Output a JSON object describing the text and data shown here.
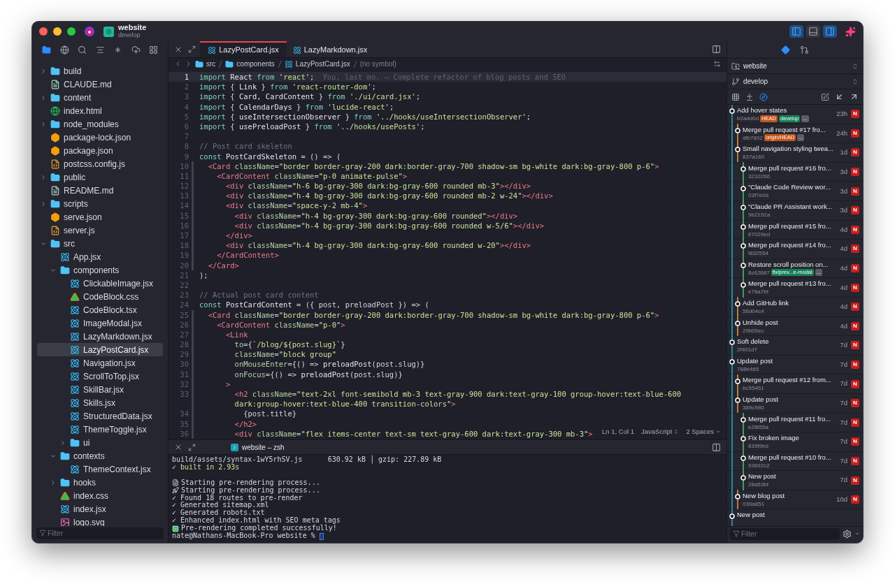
{
  "window": {
    "repo": "website",
    "branch": "develop"
  },
  "sidebar_tabs": [
    {
      "selected": true
    },
    {
      "selected": false
    },
    {
      "selected": false
    },
    {
      "selected": false
    },
    {
      "selected": false
    },
    {
      "selected": false
    },
    {
      "selected": false
    }
  ],
  "tree": [
    {
      "name": "build",
      "kind": "folder",
      "expanded": false,
      "selected": false
    },
    {
      "name": "CLAUDE.md",
      "kind": "markdown",
      "selected": false
    },
    {
      "name": "content",
      "kind": "folder",
      "expanded": false,
      "selected": false
    },
    {
      "name": "index.html",
      "kind": "html",
      "selected": false
    },
    {
      "name": "node_modules",
      "kind": "modules",
      "expanded": false,
      "selected": false
    },
    {
      "name": "package-lock.json",
      "kind": "json",
      "selected": false
    },
    {
      "name": "package.json",
      "kind": "json",
      "selected": false
    },
    {
      "name": "postcss.config.js",
      "kind": "js",
      "selected": false
    },
    {
      "name": "public",
      "kind": "folder",
      "expanded": false,
      "selected": false
    },
    {
      "name": "README.md",
      "kind": "markdown",
      "selected": false
    },
    {
      "name": "scripts",
      "kind": "folder",
      "expanded": false,
      "selected": false
    },
    {
      "name": "serve.json",
      "kind": "json",
      "selected": false
    },
    {
      "name": "server.js",
      "kind": "js",
      "selected": false
    },
    {
      "name": "src",
      "kind": "folder",
      "expanded": true,
      "selected": false,
      "children": [
        {
          "name": "App.jsx",
          "kind": "jsx",
          "selected": false
        },
        {
          "name": "components",
          "kind": "folder",
          "expanded": true,
          "selected": false,
          "children": [
            {
              "name": "ClickableImage.jsx",
              "kind": "jsx",
              "selected": false
            },
            {
              "name": "CodeBlock.css",
              "kind": "css",
              "selected": false
            },
            {
              "name": "CodeBlock.tsx",
              "kind": "jsx",
              "selected": false
            },
            {
              "name": "ImageModal.jsx",
              "kind": "jsx",
              "selected": false
            },
            {
              "name": "LazyMarkdown.jsx",
              "kind": "jsx",
              "selected": false
            },
            {
              "name": "LazyPostCard.jsx",
              "kind": "jsx",
              "selected": true
            },
            {
              "name": "Navigation.jsx",
              "kind": "jsx",
              "selected": false
            },
            {
              "name": "ScrollToTop.jsx",
              "kind": "jsx",
              "selected": false
            },
            {
              "name": "SkillBar.jsx",
              "kind": "jsx",
              "selected": false
            },
            {
              "name": "Skills.jsx",
              "kind": "jsx",
              "selected": false
            },
            {
              "name": "StructuredData.jsx",
              "kind": "jsx",
              "selected": false
            },
            {
              "name": "ThemeToggle.jsx",
              "kind": "jsx",
              "selected": false
            },
            {
              "name": "ui",
              "kind": "folder",
              "expanded": false,
              "selected": false
            }
          ]
        },
        {
          "name": "contexts",
          "kind": "folder",
          "expanded": true,
          "selected": false,
          "children": [
            {
              "name": "ThemeContext.jsx",
              "kind": "jsx",
              "selected": false
            }
          ]
        },
        {
          "name": "hooks",
          "kind": "folder",
          "expanded": false,
          "selected": false
        },
        {
          "name": "index.css",
          "kind": "css",
          "selected": false
        },
        {
          "name": "index.jsx",
          "kind": "jsx",
          "selected": false
        },
        {
          "name": "logo.svg",
          "kind": "svg",
          "selected": false
        }
      ]
    }
  ],
  "sidebar_filter": {
    "placeholder": "Filter"
  },
  "editor_tabs": [
    {
      "label": "LazyPostCard.jsx",
      "selected": true
    },
    {
      "label": "LazyMarkdown.jsx",
      "selected": false
    }
  ],
  "breadcrumbs": [
    {
      "text": "src",
      "kind": "folder"
    },
    {
      "text": "components",
      "kind": "folder"
    },
    {
      "text": "LazyPostCard.jsx",
      "kind": "jsx"
    },
    {
      "text": "(no symbol)",
      "kind": "symbol"
    }
  ],
  "code": [
    {
      "n": "1",
      "current": true,
      "changed": false,
      "t": [
        {
          "kind": "kw",
          "text": "import "
        },
        {
          "kind": "id",
          "text": "React "
        },
        {
          "kind": "kw",
          "text": "from "
        },
        {
          "kind": "str",
          "text": "'react'"
        },
        {
          "kind": "punct",
          "text": ";"
        }
      ],
      "blame": "You, last mo. — Complete refactor of blog posts and SEO"
    },
    {
      "n": "2",
      "current": false,
      "changed": false,
      "t": [
        {
          "kind": "kw",
          "text": "import "
        },
        {
          "kind": "punct",
          "text": "{ "
        },
        {
          "kind": "id",
          "text": "Link "
        },
        {
          "kind": "punct",
          "text": "} "
        },
        {
          "kind": "kw",
          "text": "from "
        },
        {
          "kind": "str",
          "text": "'react-router-dom'"
        },
        {
          "kind": "punct",
          "text": ";"
        }
      ]
    },
    {
      "n": "3",
      "current": false,
      "changed": false,
      "t": [
        {
          "kind": "kw",
          "text": "import "
        },
        {
          "kind": "punct",
          "text": "{ "
        },
        {
          "kind": "id",
          "text": "Card, CardContent "
        },
        {
          "kind": "punct",
          "text": "} "
        },
        {
          "kind": "kw",
          "text": "from "
        },
        {
          "kind": "str",
          "text": "'./ui/card.jsx'"
        },
        {
          "kind": "punct",
          "text": ";"
        }
      ]
    },
    {
      "n": "4",
      "current": false,
      "changed": false,
      "t": [
        {
          "kind": "kw",
          "text": "import "
        },
        {
          "kind": "punct",
          "text": "{ "
        },
        {
          "kind": "id",
          "text": "CalendarDays "
        },
        {
          "kind": "punct",
          "text": "} "
        },
        {
          "kind": "kw",
          "text": "from "
        },
        {
          "kind": "str",
          "text": "'lucide-react'"
        },
        {
          "kind": "punct",
          "text": ";"
        }
      ]
    },
    {
      "n": "5",
      "current": false,
      "changed": false,
      "t": [
        {
          "kind": "kw",
          "text": "import "
        },
        {
          "kind": "punct",
          "text": "{ "
        },
        {
          "kind": "id",
          "text": "useIntersectionObserver "
        },
        {
          "kind": "punct",
          "text": "} "
        },
        {
          "kind": "kw",
          "text": "from "
        },
        {
          "kind": "str",
          "text": "'../hooks/useIntersectionObserver'"
        },
        {
          "kind": "punct",
          "text": ";"
        }
      ]
    },
    {
      "n": "6",
      "current": false,
      "changed": false,
      "t": [
        {
          "kind": "kw",
          "text": "import "
        },
        {
          "kind": "punct",
          "text": "{ "
        },
        {
          "kind": "id",
          "text": "usePreloadPost "
        },
        {
          "kind": "punct",
          "text": "} "
        },
        {
          "kind": "kw",
          "text": "from "
        },
        {
          "kind": "str",
          "text": "'../hooks/usePosts'"
        },
        {
          "kind": "punct",
          "text": ";"
        }
      ]
    },
    {
      "n": "7",
      "current": false,
      "changed": false
    },
    {
      "n": "8",
      "current": false,
      "changed": false,
      "t": [
        {
          "kind": "comment",
          "text": "// Post card skeleton"
        }
      ]
    },
    {
      "n": "9",
      "current": false,
      "changed": false,
      "t": [
        {
          "kind": "kw",
          "text": "const "
        },
        {
          "kind": "id",
          "text": "PostCardSkeleton "
        },
        {
          "kind": "punct",
          "text": "= () => ("
        }
      ]
    },
    {
      "n": "10",
      "current": false,
      "changed": true,
      "t": [
        {
          "kind": "tag",
          "text": "  <Card "
        },
        {
          "kind": "attr",
          "text": "className"
        },
        {
          "kind": "punct",
          "text": "="
        },
        {
          "kind": "str",
          "text": "\"border border-gray-200 dark:border-gray-700 shadow-sm bg-white dark:bg-gray-800 p-6\""
        },
        {
          "kind": "tag",
          "text": ">"
        }
      ]
    },
    {
      "n": "11",
      "current": false,
      "changed": true,
      "t": [
        {
          "kind": "tag",
          "text": "    <CardContent "
        },
        {
          "kind": "attr",
          "text": "className"
        },
        {
          "kind": "punct",
          "text": "="
        },
        {
          "kind": "str",
          "text": "\"p-0 animate-pulse\""
        },
        {
          "kind": "tag",
          "text": ">"
        }
      ]
    },
    {
      "n": "12",
      "current": false,
      "changed": true,
      "t": [
        {
          "kind": "tag",
          "text": "      <div "
        },
        {
          "kind": "attr",
          "text": "className"
        },
        {
          "kind": "punct",
          "text": "="
        },
        {
          "kind": "str",
          "text": "\"h-6 bg-gray-300 dark:bg-gray-600 rounded mb-3\""
        },
        {
          "kind": "tag",
          "text": "></div>"
        }
      ]
    },
    {
      "n": "13",
      "current": false,
      "changed": true,
      "t": [
        {
          "kind": "tag",
          "text": "      <div "
        },
        {
          "kind": "attr",
          "text": "className"
        },
        {
          "kind": "punct",
          "text": "="
        },
        {
          "kind": "str",
          "text": "\"h-4 bg-gray-300 dark:bg-gray-600 rounded mb-2 w-24\""
        },
        {
          "kind": "tag",
          "text": "></div>"
        }
      ]
    },
    {
      "n": "14",
      "current": false,
      "changed": true,
      "t": [
        {
          "kind": "tag",
          "text": "      <div "
        },
        {
          "kind": "attr",
          "text": "className"
        },
        {
          "kind": "punct",
          "text": "="
        },
        {
          "kind": "str",
          "text": "\"space-y-2 mb-4\""
        },
        {
          "kind": "tag",
          "text": ">"
        }
      ]
    },
    {
      "n": "15",
      "current": false,
      "changed": true,
      "t": [
        {
          "kind": "tag",
          "text": "        <div "
        },
        {
          "kind": "attr",
          "text": "className"
        },
        {
          "kind": "punct",
          "text": "="
        },
        {
          "kind": "str",
          "text": "\"h-4 bg-gray-300 dark:bg-gray-600 rounded\""
        },
        {
          "kind": "tag",
          "text": "></div>"
        }
      ]
    },
    {
      "n": "16",
      "current": false,
      "changed": true,
      "t": [
        {
          "kind": "tag",
          "text": "        <div "
        },
        {
          "kind": "attr",
          "text": "className"
        },
        {
          "kind": "punct",
          "text": "="
        },
        {
          "kind": "str",
          "text": "\"h-4 bg-gray-300 dark:bg-gray-600 rounded w-5/6\""
        },
        {
          "kind": "tag",
          "text": "></div>"
        }
      ]
    },
    {
      "n": "17",
      "current": false,
      "changed": true,
      "t": [
        {
          "kind": "tag",
          "text": "      </div>"
        }
      ]
    },
    {
      "n": "18",
      "current": false,
      "changed": true,
      "t": [
        {
          "kind": "tag",
          "text": "      <div "
        },
        {
          "kind": "attr",
          "text": "className"
        },
        {
          "kind": "punct",
          "text": "="
        },
        {
          "kind": "str",
          "text": "\"h-4 bg-gray-300 dark:bg-gray-600 rounded w-20\""
        },
        {
          "kind": "tag",
          "text": "></div>"
        }
      ]
    },
    {
      "n": "19",
      "current": false,
      "changed": true,
      "t": [
        {
          "kind": "tag",
          "text": "    </CardContent>"
        }
      ]
    },
    {
      "n": "20",
      "current": false,
      "changed": true,
      "t": [
        {
          "kind": "tag",
          "text": "  </Card>"
        }
      ]
    },
    {
      "n": "21",
      "current": false,
      "changed": false,
      "t": [
        {
          "kind": "punct",
          "text": ");"
        }
      ]
    },
    {
      "n": "22",
      "current": false,
      "changed": false
    },
    {
      "n": "23",
      "current": false,
      "changed": false,
      "t": [
        {
          "kind": "comment",
          "text": "// Actual post card content"
        }
      ]
    },
    {
      "n": "24",
      "current": false,
      "changed": false,
      "t": [
        {
          "kind": "kw",
          "text": "const "
        },
        {
          "kind": "id",
          "text": "PostCardContent "
        },
        {
          "kind": "punct",
          "text": "= ({ post, preloadPost }) => ("
        }
      ]
    },
    {
      "n": "25",
      "current": false,
      "changed": true,
      "t": [
        {
          "kind": "tag",
          "text": "  <Card "
        },
        {
          "kind": "attr",
          "text": "className"
        },
        {
          "kind": "punct",
          "text": "="
        },
        {
          "kind": "str",
          "text": "\"border border-gray-200 dark:border-gray-700 shadow-sm bg-white dark:bg-gray-800 p-6\""
        },
        {
          "kind": "tag",
          "text": ">"
        }
      ]
    },
    {
      "n": "26",
      "current": false,
      "changed": true,
      "t": [
        {
          "kind": "tag",
          "text": "    <CardContent "
        },
        {
          "kind": "attr",
          "text": "className"
        },
        {
          "kind": "punct",
          "text": "="
        },
        {
          "kind": "str",
          "text": "\"p-0\""
        },
        {
          "kind": "tag",
          "text": ">"
        }
      ]
    },
    {
      "n": "27",
      "current": false,
      "changed": true,
      "t": [
        {
          "kind": "tag",
          "text": "      <Link"
        }
      ]
    },
    {
      "n": "28",
      "current": false,
      "changed": true,
      "t": [
        {
          "kind": "attr",
          "text": "        to"
        },
        {
          "kind": "punct",
          "text": "={"
        },
        {
          "kind": "str",
          "text": "`/blog/${post.slug}`"
        },
        {
          "kind": "punct",
          "text": "}"
        }
      ]
    },
    {
      "n": "29",
      "current": false,
      "changed": true,
      "t": [
        {
          "kind": "attr",
          "text": "        className"
        },
        {
          "kind": "punct",
          "text": "="
        },
        {
          "kind": "str",
          "text": "\"block group\""
        }
      ]
    },
    {
      "n": "30",
      "current": false,
      "changed": true,
      "t": [
        {
          "kind": "attr",
          "text": "        onMouseEnter"
        },
        {
          "kind": "punct",
          "text": "={() => "
        },
        {
          "kind": "id",
          "text": "preloadPost"
        },
        {
          "kind": "punct",
          "text": "(post.slug)}"
        }
      ]
    },
    {
      "n": "31",
      "current": false,
      "changed": true,
      "t": [
        {
          "kind": "attr",
          "text": "        onFocus"
        },
        {
          "kind": "punct",
          "text": "={() => "
        },
        {
          "kind": "id",
          "text": "preloadPost"
        },
        {
          "kind": "punct",
          "text": "(post.slug)}"
        }
      ]
    },
    {
      "n": "32",
      "current": false,
      "changed": true,
      "t": [
        {
          "kind": "tag",
          "text": "      >"
        }
      ]
    },
    {
      "n": "33",
      "current": false,
      "changed": true,
      "t": [
        {
          "kind": "tag",
          "text": "        <h2 "
        },
        {
          "kind": "attr",
          "text": "className"
        },
        {
          "kind": "punct",
          "text": "="
        },
        {
          "kind": "str",
          "text": "\"text-2xl font-semibold mb-3 text-gray-900 dark:text-gray-100 group-hover:text-blue-600"
        }
      ]
    },
    {
      "t": [
        {
          "kind": "str",
          "text": "        dark:group-hover:text-blue-400 transition-colors\""
        },
        {
          "kind": "tag",
          "text": ">"
        }
      ]
    },
    {
      "n": "34",
      "current": false,
      "changed": true,
      "t": [
        {
          "kind": "punct",
          "text": "          {post.title}"
        }
      ]
    },
    {
      "n": "35",
      "current": false,
      "changed": true,
      "t": [
        {
          "kind": "tag",
          "text": "        </h2>"
        }
      ]
    },
    {
      "n": "36",
      "current": false,
      "changed": true,
      "t": [
        {
          "kind": "tag",
          "text": "        <div "
        },
        {
          "kind": "attr",
          "text": "className"
        },
        {
          "kind": "punct",
          "text": "="
        },
        {
          "kind": "str",
          "text": "\"flex items-center text-sm text-gray-600 dark:text-gray-300 mb-3\""
        },
        {
          "kind": "tag",
          "text": ">"
        }
      ]
    }
  ],
  "editor_status": {
    "position": "Ln 1, Col 1",
    "language": "JavaScript",
    "indent": "2 Spaces"
  },
  "terminal": {
    "tab": "website – zsh",
    "lines": [
      {
        "kind": "plain",
        "text": "build/assets/syntax-1wY5rhSV.js      630.92 kB │ gzip: 227.89 kB"
      },
      {
        "kind": "ok",
        "text": "✓ built in 2.93s"
      },
      {
        "kind": "gap"
      },
      {
        "kind": "doc",
        "text": "Starting pre-rendering process..."
      },
      {
        "kind": "rocket",
        "text": "Starting pre-rendering process..."
      },
      {
        "kind": "plain",
        "text": "✓ Found 18 routes to pre-render"
      },
      {
        "kind": "plain",
        "text": "✓ Generated sitemap.xml"
      },
      {
        "kind": "plain",
        "text": "✓ Generated robots.txt"
      },
      {
        "kind": "plain",
        "text": "✓ Enhanced index.html with SEO meta tags"
      },
      {
        "kind": "success",
        "text": "Pre-rendering completed successfully!"
      },
      {
        "kind": "prompt",
        "text": "nate@Nathans-MacBook-Pro website % "
      }
    ]
  },
  "layout_toggles": [
    {
      "on": true
    },
    {
      "on": false
    },
    {
      "on": true
    }
  ],
  "git_tabs": [
    {
      "selected": true
    },
    {
      "selected": false
    }
  ],
  "git": {
    "repo": "website",
    "branch": "develop"
  },
  "commits": [
    {
      "title": "Add hover states",
      "hash": "b2add0d",
      "time": "23h",
      "author": "N",
      "kind": "trunk",
      "tags": [
        {
          "text": "HEAD",
          "color": "#c2551b"
        },
        {
          "text": "develop",
          "color": "#17805a"
        },
        {
          "text": "...",
          "color": "#5a5d68"
        }
      ]
    },
    {
      "title": "Merge pull request #17 fro...",
      "hash": "dfb7802",
      "time": "24h",
      "author": "N",
      "kind": "branch",
      "tags": [
        {
          "text": "origin/HEAD",
          "color": "#c2551b"
        },
        {
          "text": "...",
          "color": "#5a5d68"
        }
      ]
    },
    {
      "title": "Small navigation styling twea...",
      "hash": "837a160",
      "time": "1d",
      "author": "N",
      "kind": "branch"
    },
    {
      "title": "Merge pull request #16 fro...",
      "hash": "3210266",
      "time": "3d",
      "author": "N",
      "kind": "twig"
    },
    {
      "title": "\"Claude Code Review wor...",
      "hash": "03f7e0d",
      "time": "3d",
      "author": "N",
      "kind": "twig"
    },
    {
      "title": "\"Claude PR Assistant work...",
      "hash": "9b2192a",
      "time": "3d",
      "author": "N",
      "kind": "twig"
    },
    {
      "title": "Merge pull request #15 fro...",
      "hash": "67029ed",
      "time": "4d",
      "author": "N",
      "kind": "twig"
    },
    {
      "title": "Merge pull request #14 fro...",
      "hash": "f832554",
      "time": "4d",
      "author": "N",
      "kind": "twig"
    },
    {
      "title": "Restore scroll position on...",
      "hash": "8c62687",
      "time": "4d",
      "author": "N",
      "kind": "twig",
      "tags": [
        {
          "text": "fix/prev...e-modal",
          "color": "#17805a"
        },
        {
          "text": "...",
          "color": "#5a5d68"
        }
      ]
    },
    {
      "title": "Merge pull request #13 fro...",
      "hash": "e76a7bf",
      "time": "4d",
      "author": "N",
      "kind": "twig"
    },
    {
      "title": "Add GitHub link",
      "hash": "56d04c4",
      "time": "4d",
      "author": "N",
      "kind": "branch"
    },
    {
      "title": "Unhide post",
      "hash": "29b05ec",
      "time": "4d",
      "author": "N",
      "kind": "branch"
    },
    {
      "title": "Soft delete",
      "hash": "2f401d7",
      "time": "7d",
      "author": "N",
      "kind": "trunk"
    },
    {
      "title": "Update post",
      "hash": "788b465",
      "time": "7d",
      "author": "N",
      "kind": "trunk"
    },
    {
      "title": "Merge pull request #12 from...",
      "hash": "bc55451",
      "time": "7d",
      "author": "N",
      "kind": "branch"
    },
    {
      "title": "Update post",
      "hash": "389c980",
      "time": "7d",
      "author": "N",
      "kind": "branch"
    },
    {
      "title": "Merge pull request #11 fro...",
      "hash": "e2f855a",
      "time": "7d",
      "author": "N",
      "kind": "twig"
    },
    {
      "title": "Fix broken image",
      "hash": "839f9bd",
      "time": "7d",
      "author": "N",
      "kind": "twig"
    },
    {
      "title": "Merge pull request #10 fro...",
      "hash": "93692c2",
      "time": "7d",
      "author": "N",
      "kind": "twig"
    },
    {
      "title": "New post",
      "hash": "28a53bf",
      "time": "7d",
      "author": "N",
      "kind": "twig"
    },
    {
      "title": "New blog post",
      "hash": "039a851",
      "time": "10d",
      "author": "N",
      "kind": "branch"
    },
    {
      "title": "New post",
      "kind": "trunk"
    }
  ],
  "git_filter": {
    "placeholder": "Filter"
  }
}
